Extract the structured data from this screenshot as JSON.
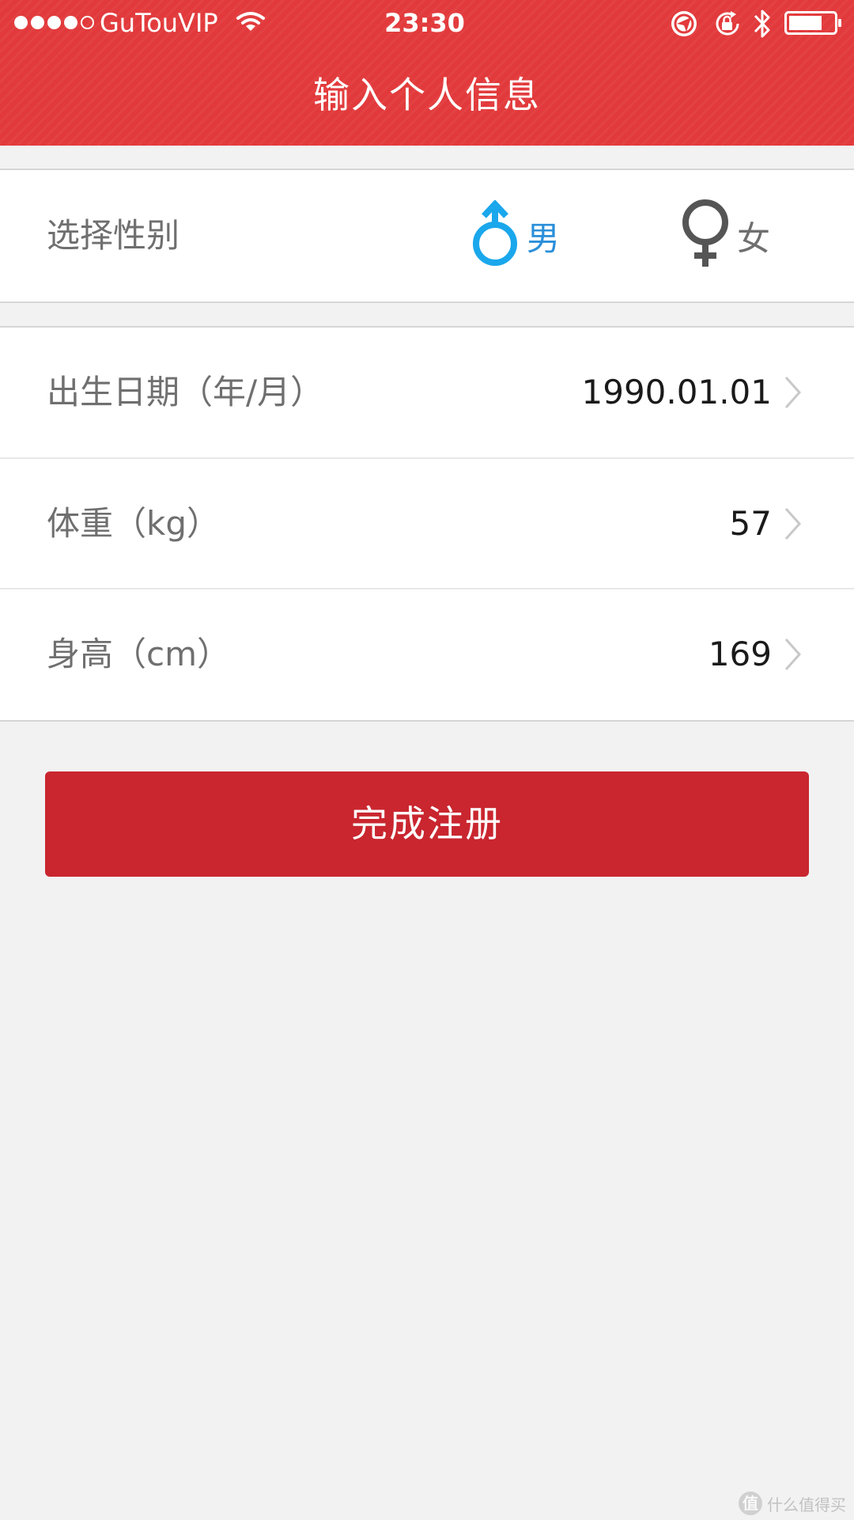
{
  "status_bar": {
    "carrier": "GuTouVIP",
    "time": "23:30",
    "signal_bars_filled": 4,
    "signal_bars_total": 5,
    "battery_level": 0.75,
    "icons": [
      "wifi-icon",
      "location-icon",
      "rotation-lock-icon",
      "bluetooth-icon",
      "battery-icon"
    ]
  },
  "nav": {
    "title": "输入个人信息"
  },
  "gender": {
    "label": "选择性别",
    "male": "男",
    "female": "女",
    "selected": "male",
    "colors": {
      "male_selected": "#1aa7ec",
      "female_unselected": "#555555"
    }
  },
  "fields": [
    {
      "label": "出生日期（年/月）",
      "value": "1990.01.01"
    },
    {
      "label": "体重（kg）",
      "value": "57"
    },
    {
      "label": "身高（cm）",
      "value": "169"
    }
  ],
  "submit": {
    "label": "完成注册"
  },
  "watermark": {
    "text": "什么值得买"
  },
  "colors": {
    "header_red": "#e23a3c",
    "button_red": "#c9262f",
    "background": "#f2f2f2"
  }
}
